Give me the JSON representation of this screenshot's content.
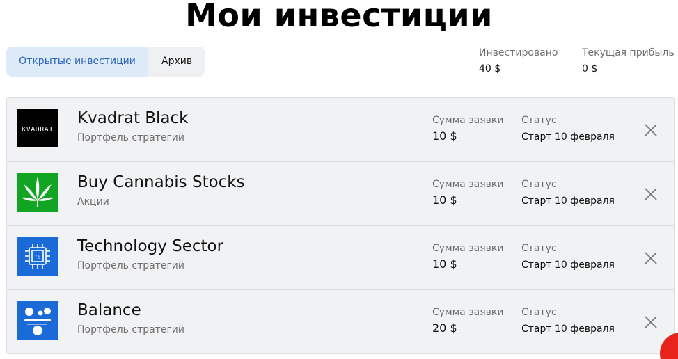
{
  "header": {
    "title": "Мои инвестиции"
  },
  "tabs": [
    {
      "label": "Открытые инвестиции",
      "active": true
    },
    {
      "label": "Архив",
      "active": false
    }
  ],
  "stats": {
    "invested_label": "Инвестировано",
    "invested_value": "40 $",
    "profit_label": "Текущая прибыль",
    "profit_value": "0 $"
  },
  "investments": [
    {
      "name": "Kvadrat Black",
      "category": "Портфель стратегий",
      "amount_label": "Сумма заявки",
      "amount": "10 $",
      "status_label": "Статус",
      "status": "Старт 10 февраля",
      "logo_icon": "kvadrat-logo",
      "logo_text": "KVADRAT",
      "logo_color": "#000000"
    },
    {
      "name": "Buy Cannabis Stocks",
      "category": "Акции",
      "amount_label": "Сумма заявки",
      "amount": "10 $",
      "status_label": "Статус",
      "status": "Старт 10 февраля",
      "logo_icon": "cannabis-leaf-icon",
      "logo_color": "#12a523"
    },
    {
      "name": "Technology Sector",
      "category": "Портфель стратегий",
      "amount_label": "Сумма заявки",
      "amount": "10 $",
      "status_label": "Статус",
      "status": "Старт 10 февраля",
      "logo_icon": "chip-icon",
      "logo_text": "TS",
      "logo_color": "#1a6ad8"
    },
    {
      "name": "Balance",
      "category": "Портфель стратегий",
      "amount_label": "Сумма заявки",
      "amount": "20 $",
      "status_label": "Статус",
      "status": "Старт 10 февраля",
      "logo_icon": "balance-scale-icon",
      "logo_color": "#1a6ad8"
    }
  ],
  "colors": {
    "accent": "#2a63b8",
    "tab_active_bg": "#ddebf8",
    "row_bg": "#f1f2f4",
    "fab": "#e8231b"
  }
}
